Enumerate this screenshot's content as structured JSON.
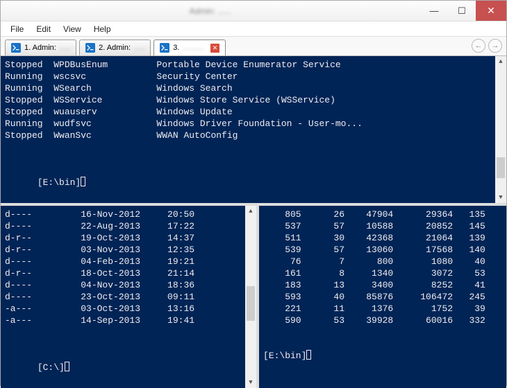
{
  "window": {
    "title": "Admin: ......"
  },
  "menu": {
    "file": "File",
    "edit": "Edit",
    "view": "View",
    "help": "Help"
  },
  "tabs": {
    "t1": "1. Admin:",
    "t2": "2. Admin:",
    "t3": "3."
  },
  "top_pane": {
    "rows": [
      {
        "status": "Stopped",
        "name": "WPDBusEnum",
        "desc": "Portable Device Enumerator Service"
      },
      {
        "status": "Running",
        "name": "wscsvc",
        "desc": "Security Center"
      },
      {
        "status": "Running",
        "name": "WSearch",
        "desc": "Windows Search"
      },
      {
        "status": "Stopped",
        "name": "WSService",
        "desc": "Windows Store Service (WSService)"
      },
      {
        "status": "Stopped",
        "name": "wuauserv",
        "desc": "Windows Update"
      },
      {
        "status": "Running",
        "name": "wudfsvc",
        "desc": "Windows Driver Foundation - User-mo..."
      },
      {
        "status": "Stopped",
        "name": "WwanSvc",
        "desc": "WWAN AutoConfig"
      }
    ],
    "prompt": "[E:\\bin]"
  },
  "left_pane": {
    "rows": [
      {
        "mode": "d----",
        "date": "16-Nov-2012",
        "time": "20:50"
      },
      {
        "mode": "d----",
        "date": "22-Aug-2013",
        "time": "17:22"
      },
      {
        "mode": "d-r--",
        "date": "19-Oct-2013",
        "time": "14:37"
      },
      {
        "mode": "d-r--",
        "date": "03-Nov-2013",
        "time": "12:35"
      },
      {
        "mode": "d----",
        "date": "04-Feb-2013",
        "time": "19:21"
      },
      {
        "mode": "d-r--",
        "date": "18-Oct-2013",
        "time": "21:14"
      },
      {
        "mode": "d----",
        "date": "04-Nov-2013",
        "time": "18:36"
      },
      {
        "mode": "d----",
        "date": "23-Oct-2013",
        "time": "09:11"
      },
      {
        "mode": "-a---",
        "date": "03-Oct-2013",
        "time": "13:16"
      },
      {
        "mode": "-a---",
        "date": "14-Sep-2013",
        "time": "19:41"
      }
    ],
    "prompt": "[C:\\]"
  },
  "right_pane": {
    "rows": [
      {
        "c1": "805",
        "c2": "26",
        "c3": "47904",
        "c4": "29364",
        "c5": "135"
      },
      {
        "c1": "537",
        "c2": "57",
        "c3": "10588",
        "c4": "20852",
        "c5": "145"
      },
      {
        "c1": "511",
        "c2": "30",
        "c3": "42368",
        "c4": "21064",
        "c5": "139"
      },
      {
        "c1": "539",
        "c2": "57",
        "c3": "13060",
        "c4": "17568",
        "c5": "140"
      },
      {
        "c1": "76",
        "c2": "7",
        "c3": "800",
        "c4": "1080",
        "c5": "40"
      },
      {
        "c1": "161",
        "c2": "8",
        "c3": "1340",
        "c4": "3072",
        "c5": "53"
      },
      {
        "c1": "183",
        "c2": "13",
        "c3": "3400",
        "c4": "8252",
        "c5": "41"
      },
      {
        "c1": "593",
        "c2": "40",
        "c3": "85876",
        "c4": "106472",
        "c5": "245"
      },
      {
        "c1": "221",
        "c2": "11",
        "c3": "1376",
        "c4": "1752",
        "c5": "39"
      },
      {
        "c1": "590",
        "c2": "53",
        "c3": "39928",
        "c4": "60016",
        "c5": "332"
      }
    ],
    "prompt": "[E:\\bin]"
  }
}
